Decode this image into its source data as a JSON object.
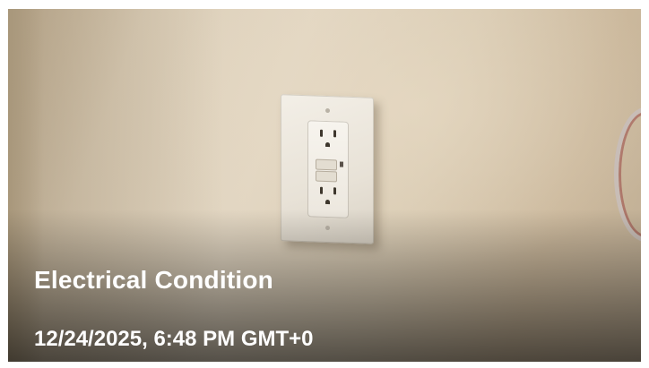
{
  "card": {
    "title": "Electrical Condition",
    "timestamp": "12/24/2025, 6:48 PM GMT+0"
  },
  "photo": {
    "subject": "wall outlet",
    "colors": {
      "wall": "#ddd0ba",
      "plate": "#f3efe7",
      "overlay_text": "#ffffff"
    }
  }
}
